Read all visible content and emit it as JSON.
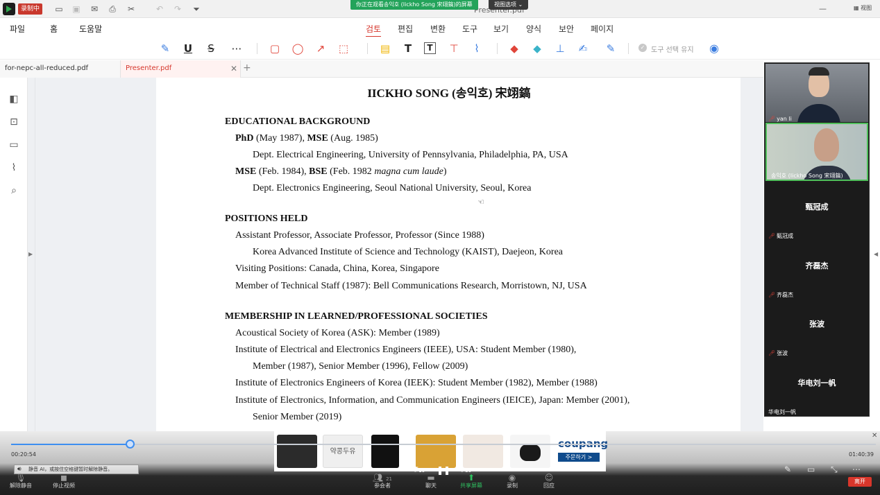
{
  "window": {
    "rec_label": "录制中",
    "share_banner": "你正在观看송익호 (Iickho Song 宋翊鎬)的屏幕",
    "view_options": "视图选项 ⌄",
    "doc_title": "Presenter.pdf",
    "layout_label": "▦ 视图",
    "controls": {
      "minimize": "—",
      "restore": "❐",
      "close": "✕"
    }
  },
  "menu": {
    "left": [
      "파일",
      "홈",
      "도움말"
    ],
    "center": [
      "검토",
      "편집",
      "변환",
      "도구",
      "보기",
      "양식",
      "보안",
      "페이지"
    ],
    "active": "검토"
  },
  "toolbar": {
    "keep_tool_label": "도구 선택 유지",
    "icons": [
      "highlight-icon",
      "underline-icon",
      "strikethrough-icon",
      "more-icon",
      "rectangle-icon",
      "circle-icon",
      "arrow-icon",
      "stamp-shape-icon",
      "note-icon",
      "text-icon",
      "textbox-icon",
      "callout-icon",
      "attach-icon",
      "eraser-icon",
      "clear-icon",
      "stamp-icon",
      "signature-icon",
      "pen-icon",
      "eye-icon"
    ]
  },
  "tabs": [
    {
      "label": "for-nepc-all-reduced.pdf",
      "active": false
    },
    {
      "label": "Presenter.pdf",
      "active": true
    }
  ],
  "document": {
    "title": "IICKHO SONG (송익호)  宋翊鎬",
    "lines": [
      {
        "kind": "head",
        "text": "EDUCATIONAL BACKGROUND"
      },
      {
        "kind": "l1",
        "html_parts": [
          [
            "b",
            "PhD"
          ],
          [
            "n",
            " (May 1987), "
          ],
          [
            "b",
            "MSE"
          ],
          [
            "n",
            " (Aug. 1985)"
          ]
        ]
      },
      {
        "kind": "l2",
        "text": "Dept. Electrical Engineering, University of Pennsylvania, Philadelphia, PA, USA"
      },
      {
        "kind": "l1",
        "html_parts": [
          [
            "b",
            "MSE"
          ],
          [
            "n",
            " (Feb. 1984), "
          ],
          [
            "b",
            "BSE"
          ],
          [
            "n",
            " (Feb. 1982 "
          ],
          [
            "i",
            "magna cum laude"
          ],
          [
            "n",
            ")"
          ]
        ]
      },
      {
        "kind": "l2",
        "text": "Dept. Electronics Engineering, Seoul National University, Seoul, Korea"
      },
      {
        "kind": "head",
        "text": "POSITIONS HELD"
      },
      {
        "kind": "l1",
        "text": "Assistant Professor, Associate Professor, Professor (Since 1988)"
      },
      {
        "kind": "l2",
        "text": "Korea Advanced Institute of Science and Technology (KAIST), Daejeon, Korea"
      },
      {
        "kind": "l1",
        "text": "Visiting Positions: Canada, China, Korea, Singapore"
      },
      {
        "kind": "l1",
        "text": "Member of Technical Staff (1987): Bell Communications Research, Morristown, NJ, USA"
      },
      {
        "kind": "head",
        "text": "MEMBERSHIP IN LEARNED/PROFESSIONAL SOCIETIES"
      },
      {
        "kind": "l1",
        "text": "Acoustical Society of Korea (ASK): Member (1989)"
      },
      {
        "kind": "l1",
        "text": "Institute of Electrical and Electronics Engineers (IEEE), USA: Student Member (1980),"
      },
      {
        "kind": "l2",
        "text": "Member (1987), Senior Member (1996), Fellow (2009)"
      },
      {
        "kind": "l1",
        "text": "Institute of Electronics Engineers of Korea (IEEK): Student Member (1982), Member (1988)"
      },
      {
        "kind": "l1",
        "text": "Institute of Electronics, Information, and Communication Engineers (IEICE), Japan: Member (2001),"
      },
      {
        "kind": "l2",
        "text": "Senior Member (2019)"
      }
    ]
  },
  "participants": [
    {
      "name": "yan li",
      "video": true
    },
    {
      "name": "송익호 (Iickho Song 宋翊鎬)",
      "video": true,
      "speaking": true
    },
    {
      "name": "甄冠成",
      "video": false
    },
    {
      "name": "齐磊杰",
      "video": false
    },
    {
      "name": "张波",
      "video": false
    },
    {
      "name": "华电刘一帆",
      "video": false
    }
  ],
  "player": {
    "current_time": "00:20:54",
    "total_time": "01:40:39",
    "progress_fraction": 0.138,
    "ad_brand": "coupang",
    "ad_button": "주문하기 >",
    "ad_product_text": "약콩두유",
    "tip": "静音 AI，或按住空格键暂时解除静音。",
    "skip_back": "10",
    "skip_fwd": "30"
  },
  "meeting_toolbar": {
    "unmute": "解除静音",
    "stop_video": "停止视频",
    "participants": "参会者",
    "participants_count": "21",
    "chat": "聊天",
    "share": "共享屏幕",
    "record": "录制",
    "reactions": "回应",
    "leave": "离开"
  },
  "colors": {
    "accent": "#d6362c",
    "share_green": "#23a35a",
    "progress": "#3d8ef0"
  }
}
